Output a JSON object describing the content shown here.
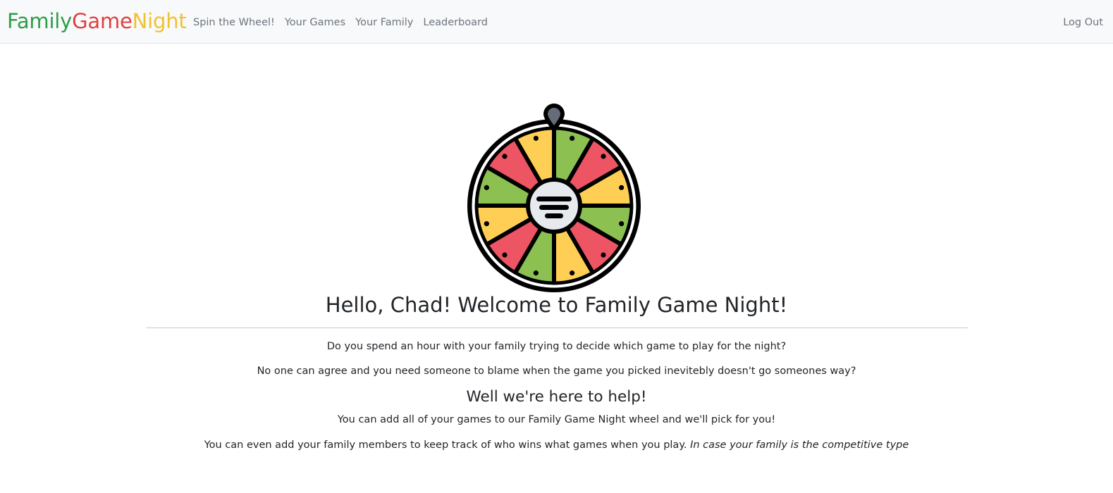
{
  "brand": {
    "part1": "Family",
    "part2": "Game",
    "part3": "Night",
    "colors": [
      "#2e9e47",
      "#e04040",
      "#f2c12e"
    ]
  },
  "nav": {
    "links": [
      "Spin the Wheel!",
      "Your Games",
      "Your Family",
      "Leaderboard"
    ],
    "logout": "Log Out"
  },
  "hero": {
    "icon": "spin-wheel-icon",
    "wheel_colors": {
      "green": "#8cc152",
      "yellow": "#ffce54",
      "red": "#ed5565",
      "outline": "#000000",
      "hub": "#e6e9ed",
      "pointer": "#656d78"
    },
    "title": "Hello, Chad! Welcome to Family Game Night!"
  },
  "content": {
    "p1": "Do you spend an hour with your family trying to decide which game to play for the night?",
    "p2": "No one can agree and you need someone to blame when the game you picked inevitebly doesn't go someones way?",
    "subheading": "Well we're here to help!",
    "p3": "You can add all of your games to our Family Game Night wheel and we'll pick for you!",
    "p4": "You can even add your family members to keep track of who wins what games when you play.",
    "p4_italic": "In case your family is the competitive type"
  }
}
